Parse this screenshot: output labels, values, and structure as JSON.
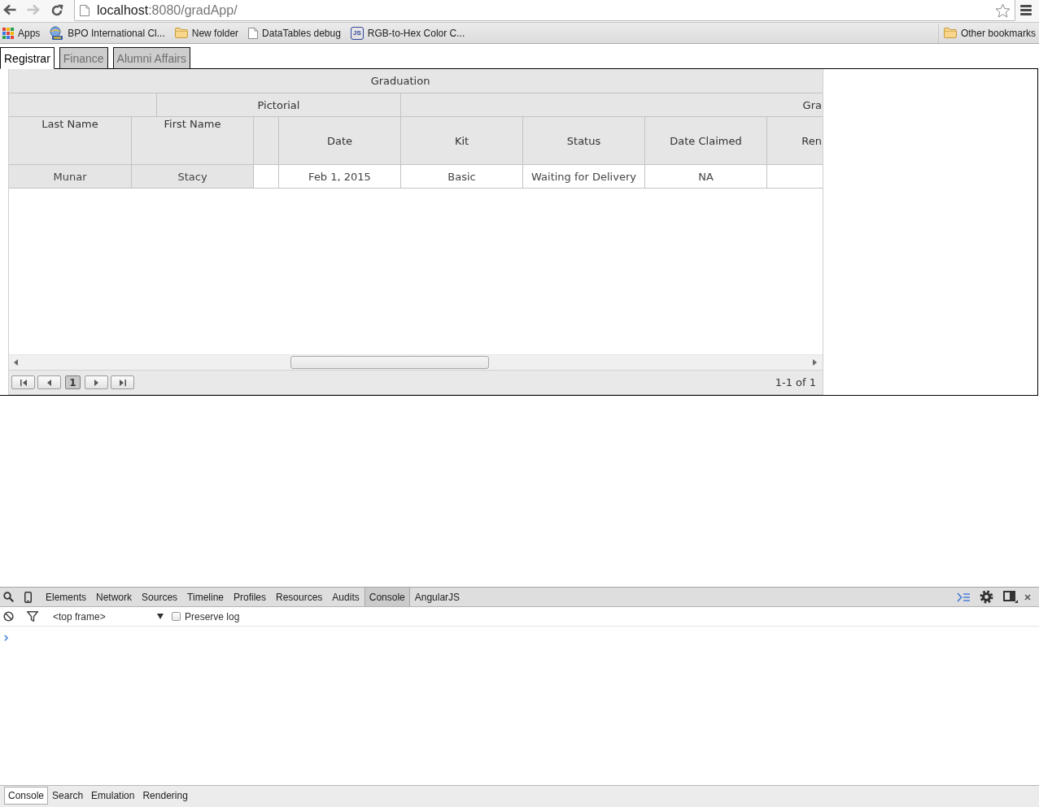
{
  "browser": {
    "address": {
      "host": "localhost",
      "path": ":8080/gradApp/"
    },
    "bookmarks": [
      {
        "kind": "apps",
        "label": "Apps"
      },
      {
        "kind": "site",
        "label": "BPO International Cl..."
      },
      {
        "kind": "folder",
        "label": "New folder"
      },
      {
        "kind": "page",
        "label": "DataTables debug"
      },
      {
        "kind": "js",
        "badge": "JS",
        "label": "RGB-to-Hex Color C..."
      }
    ],
    "other_bookmarks": {
      "kind": "folder",
      "label": "Other bookmarks"
    }
  },
  "tabs": [
    {
      "label": "Registrar",
      "selected": true
    },
    {
      "label": "Finance",
      "selected": false
    },
    {
      "label": "Alumni Affairs",
      "selected": false
    }
  ],
  "grid": {
    "title": "Graduation",
    "column_groups": [
      {
        "kind": "blank"
      },
      {
        "kind": "group",
        "label": "Pictorial"
      },
      {
        "kind": "group",
        "label": "Gra"
      }
    ],
    "columns": [
      {
        "kind": "pinned",
        "label": "Last Name"
      },
      {
        "kind": "pinned",
        "label": "First Name"
      },
      {
        "kind": "spacer"
      },
      {
        "kind": "data",
        "label": "Date"
      },
      {
        "kind": "data",
        "label": "Kit"
      },
      {
        "kind": "data",
        "label": "Status"
      },
      {
        "kind": "data",
        "label": "Date Claimed"
      },
      {
        "kind": "data",
        "label": "Ren"
      }
    ],
    "rows": [
      {
        "cells": [
          "Munar",
          "Stacy",
          "",
          "Feb 1, 2015",
          "Basic",
          "Waiting for Delivery",
          "NA"
        ]
      }
    ],
    "pager": {
      "pages": [
        {
          "label": "1",
          "selected": true
        }
      ],
      "summary": "1-1 of 1"
    }
  },
  "devtools": {
    "tabs": [
      {
        "label": "Elements",
        "selected": false
      },
      {
        "label": "Network",
        "selected": false
      },
      {
        "label": "Sources",
        "selected": false
      },
      {
        "label": "Timeline",
        "selected": false
      },
      {
        "label": "Profiles",
        "selected": false
      },
      {
        "label": "Resources",
        "selected": false
      },
      {
        "label": "Audits",
        "selected": false
      },
      {
        "label": "Console",
        "selected": true
      },
      {
        "label": "AngularJS",
        "selected": false
      }
    ],
    "frame": "<top frame>",
    "preserve_log": {
      "label": "Preserve log",
      "checked": false
    },
    "drawer_tabs": [
      {
        "label": "Console",
        "selected": true
      },
      {
        "label": "Search",
        "selected": false
      },
      {
        "label": "Emulation",
        "selected": false
      },
      {
        "label": "Rendering",
        "selected": false
      }
    ]
  }
}
